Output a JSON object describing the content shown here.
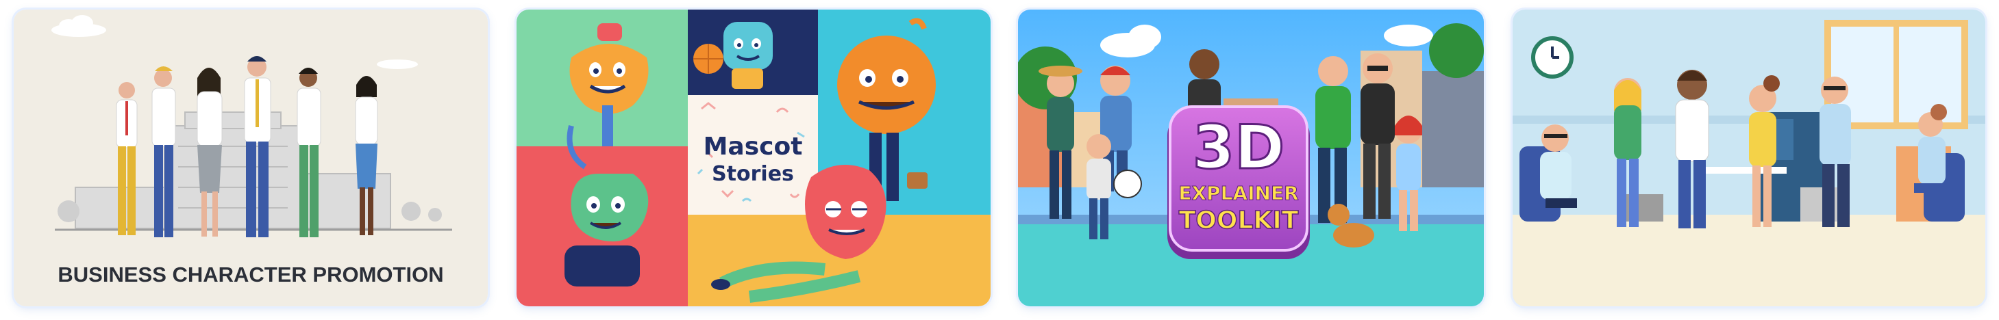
{
  "cards": [
    {
      "caption": "BUSINESS CHARACTER PROMOTION",
      "bg": "#f1ede4"
    },
    {
      "title_line1": "Mascot",
      "title_line2": "Stories",
      "colors": {
        "green": "#7fd7a6",
        "navy": "#1f2f67",
        "cyan": "#3ec6dc",
        "red": "#ee5a5f",
        "yellow": "#f7bb49"
      }
    },
    {
      "badge_line1": "3D",
      "badge_line2": "EXPLAINER",
      "badge_line3": "TOOLKIT",
      "colors": {
        "sky": "#78c6ff",
        "badge": "#c35bd0",
        "ground": "#4fd0d0"
      }
    },
    {
      "colors": {
        "bg": "#cbe6f3",
        "floor": "#f7f0da"
      }
    }
  ]
}
